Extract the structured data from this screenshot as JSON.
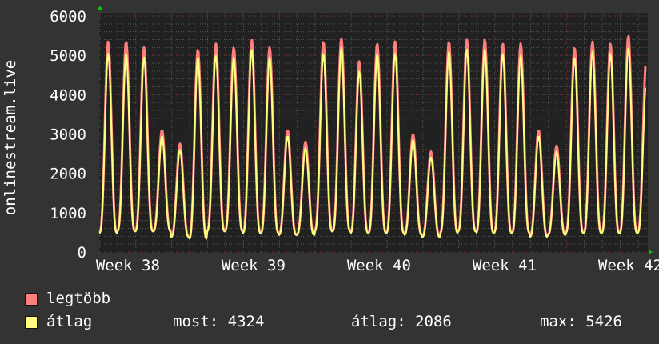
{
  "chart_data": {
    "type": "line",
    "ylabel": "onlinestream.live",
    "ylim": [
      0,
      6000
    ],
    "yticks": [
      "0",
      "1000",
      "2000",
      "3000",
      "4000",
      "5000",
      "6000"
    ],
    "xticks": [
      "Week 38",
      "Week 39",
      "Week 40",
      "Week 41",
      "Week 42"
    ],
    "x_unit": "days",
    "grid": true,
    "series": [
      {
        "name": "legtöbb",
        "color": "#ff7f7f",
        "daily_peaks": [
          5350,
          5350,
          5200,
          3100,
          2750,
          5150,
          5300,
          5200,
          5400,
          5200,
          3100,
          2800,
          5350,
          5430,
          4850,
          5300,
          5350,
          3000,
          2550,
          5350,
          5400,
          5400,
          5300,
          5300,
          3100,
          2700,
          5200,
          5350,
          5300,
          5500,
          4900
        ],
        "daily_lows": [
          500,
          550,
          550,
          550,
          400,
          350,
          550,
          550,
          500,
          500,
          450,
          450,
          550,
          550,
          500,
          500,
          500,
          450,
          400,
          500,
          550,
          500,
          500,
          500,
          400,
          450,
          500,
          500,
          500,
          500,
          500
        ]
      },
      {
        "name": "átlag",
        "color": "#ffff7f",
        "daily_peaks": [
          5050,
          5050,
          4950,
          2950,
          2600,
          4950,
          5000,
          4950,
          5150,
          4950,
          2950,
          2650,
          5050,
          5200,
          4600,
          5050,
          5050,
          2850,
          2400,
          5100,
          5150,
          5150,
          5050,
          5000,
          2950,
          2550,
          4950,
          5100,
          5050,
          5200,
          4324
        ],
        "daily_lows": [
          480,
          520,
          520,
          520,
          380,
          330,
          520,
          520,
          480,
          480,
          430,
          430,
          520,
          520,
          480,
          480,
          480,
          430,
          380,
          480,
          520,
          480,
          480,
          480,
          380,
          430,
          480,
          480,
          480,
          480,
          480
        ]
      }
    ]
  },
  "legend": {
    "items": [
      {
        "label": "legtöbb",
        "color": "#ff7f7f"
      },
      {
        "label": "átlag",
        "color": "#ffff7f"
      }
    ],
    "stats": {
      "most": "most: 4324",
      "avg": "átlag: 2086",
      "max": "max: 5426"
    }
  }
}
